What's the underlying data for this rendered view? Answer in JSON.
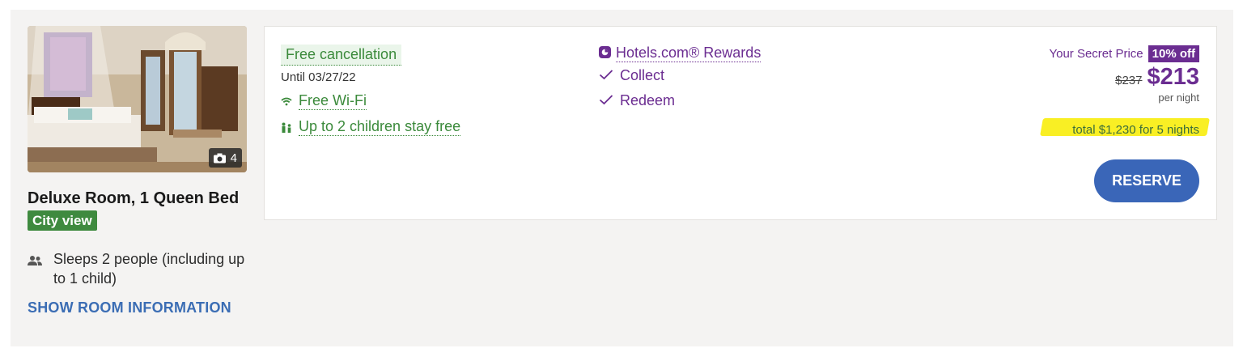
{
  "room": {
    "photo_count": "4",
    "title": "Deluxe Room, 1 Queen Bed",
    "view": "City view",
    "sleeps": "Sleeps 2 people (including up to 1 child)",
    "show_info": "SHOW ROOM INFORMATION"
  },
  "offer": {
    "free_cancellation": "Free cancellation",
    "cancel_until": "Until 03/27/22",
    "amenities": [
      {
        "label": "Free Wi-Fi",
        "icon": "wifi-icon"
      },
      {
        "label": "Up to 2 children stay free",
        "icon": "family-icon"
      }
    ],
    "rewards": {
      "label": "Hotels.com® Rewards",
      "items": [
        "Collect",
        "Redeem"
      ]
    }
  },
  "price": {
    "secret_label": "Your Secret Price",
    "discount": "10% off",
    "old": "$237",
    "new": "$213",
    "per_night": "per night",
    "total": "total $1,230 for 5 nights",
    "reserve": "RESERVE"
  },
  "colors": {
    "purple": "#6b2d91",
    "green": "#3b8a3b",
    "reserve_blue": "#3a66b8",
    "highlight": "#f9ef24"
  }
}
